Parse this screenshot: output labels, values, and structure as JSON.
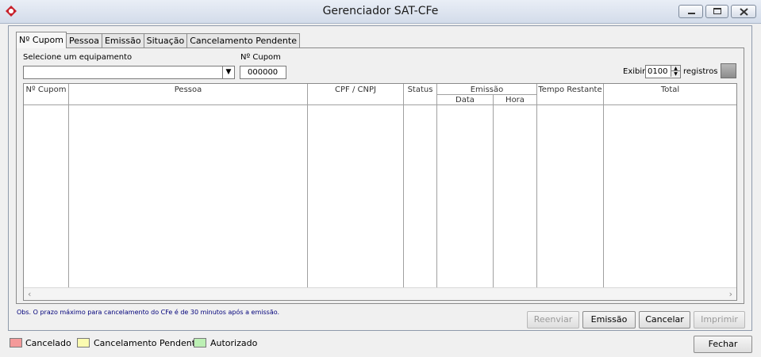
{
  "window": {
    "title": "Gerenciador SAT-CFe",
    "icon": "app-logo-icon"
  },
  "tabs": [
    {
      "label": "Nº Cupom",
      "active": true
    },
    {
      "label": "Pessoa",
      "active": false
    },
    {
      "label": "Emissão",
      "active": false
    },
    {
      "label": "Situação",
      "active": false
    },
    {
      "label": "Cancelamento Pendente",
      "active": false
    }
  ],
  "filters": {
    "equipamento_label": "Selecione um equipamento",
    "equipamento_value": "",
    "cupom_label": "Nº Cupom",
    "cupom_value": "000000",
    "exibir_label": "Exibir",
    "exibir_value": "0100",
    "registros_label": "registros"
  },
  "table": {
    "columns": {
      "cupom": "Nº Cupom",
      "pessoa": "Pessoa",
      "cpf": "CPF / CNPJ",
      "status": "Status",
      "emissao": "Emissão",
      "data": "Data",
      "hora": "Hora",
      "tempo": "Tempo Restante",
      "total": "Total"
    },
    "rows": []
  },
  "obs": "Obs. O prazo máximo para cancelamento do CFe é de 30 minutos após a emissão.",
  "buttons": {
    "reenviar": "Reenviar",
    "emissao": "Emissão",
    "cancelar": "Cancelar",
    "imprimir": "Imprimir",
    "fechar": "Fechar"
  },
  "legend": [
    {
      "label": "Cancelado",
      "color": "#f49a9a"
    },
    {
      "label": "Cancelamento Pendente",
      "color": "#fbfbb0"
    },
    {
      "label": "Autorizado",
      "color": "#bcf0b4"
    }
  ]
}
